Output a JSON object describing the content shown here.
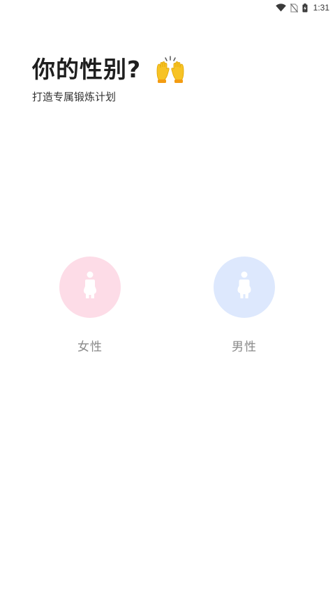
{
  "status_bar": {
    "time": "1:31",
    "icons": [
      "wifi-icon",
      "no-sim-icon",
      "battery-charging-icon"
    ]
  },
  "header": {
    "title": "你的性别?",
    "emoji_icon": "raising-hands-icon",
    "subtitle": "打造专属锻炼计划"
  },
  "genders": [
    {
      "label": "女性",
      "icon": "female-silhouette-icon",
      "color": "#fddce7"
    },
    {
      "label": "男性",
      "icon": "male-silhouette-icon",
      "color": "#dde8fd"
    }
  ]
}
